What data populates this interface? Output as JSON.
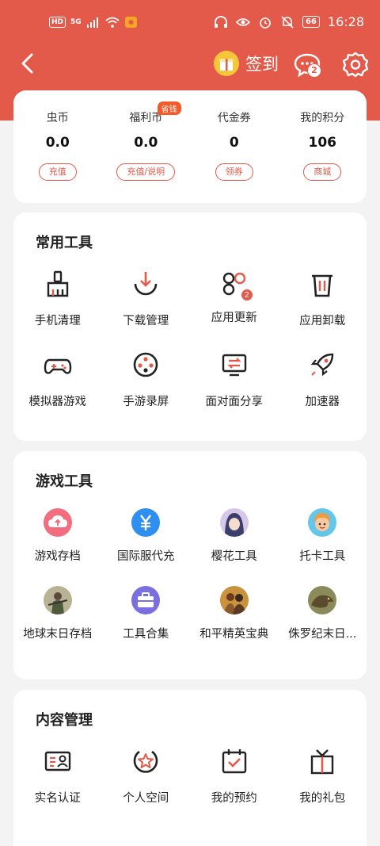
{
  "status_bar": {
    "time": "16:28",
    "battery": "66",
    "hd": "HD",
    "net": "5G"
  },
  "header": {
    "sign_label": "签到",
    "message_badge": "2"
  },
  "wallet": [
    {
      "label": "虫币",
      "value": "0.0",
      "button": "充值"
    },
    {
      "label": "福利币",
      "value": "0.0",
      "button": "充值/说明",
      "tag": "省钱"
    },
    {
      "label": "代金券",
      "value": "0",
      "button": "领券"
    },
    {
      "label": "我的积分",
      "value": "106",
      "button": "商城"
    }
  ],
  "common_tools": {
    "title": "常用工具",
    "items": [
      {
        "label": "手机清理",
        "icon": "broom-icon"
      },
      {
        "label": "下载管理",
        "icon": "download-icon"
      },
      {
        "label": "应用更新",
        "icon": "apps-update-icon",
        "badge": "2"
      },
      {
        "label": "应用卸载",
        "icon": "trash-icon"
      },
      {
        "label": "模拟器游戏",
        "icon": "gamepad-icon"
      },
      {
        "label": "手游录屏",
        "icon": "film-reel-icon"
      },
      {
        "label": "面对面分享",
        "icon": "share-screen-icon"
      },
      {
        "label": "加速器",
        "icon": "rocket-icon"
      }
    ]
  },
  "game_tools": {
    "title": "游戏工具",
    "items": [
      {
        "label": "游戏存档",
        "icon": "cloud-upload-icon"
      },
      {
        "label": "国际服代充",
        "icon": "yuan-icon"
      },
      {
        "label": "樱花工具",
        "icon": "anime-avatar-icon"
      },
      {
        "label": "托卡工具",
        "icon": "toca-avatar-icon"
      },
      {
        "label": "地球末日存档",
        "icon": "soldier-avatar-icon"
      },
      {
        "label": "工具合集",
        "icon": "toolbox-icon"
      },
      {
        "label": "和平精英宝典",
        "icon": "pubg-avatar-icon"
      },
      {
        "label": "侏罗纪末日...",
        "icon": "jurassic-avatar-icon"
      }
    ]
  },
  "content_management": {
    "title": "内容管理",
    "items": [
      {
        "label": "实名认证",
        "icon": "id-card-icon"
      },
      {
        "label": "个人空间",
        "icon": "star-circle-icon"
      },
      {
        "label": "我的预约",
        "icon": "calendar-check-icon"
      },
      {
        "label": "我的礼包",
        "icon": "gift-box-icon"
      }
    ]
  },
  "colors": {
    "accent": "#e45a4a",
    "background": "#f3f3f3",
    "tag": "#f25b2a"
  }
}
